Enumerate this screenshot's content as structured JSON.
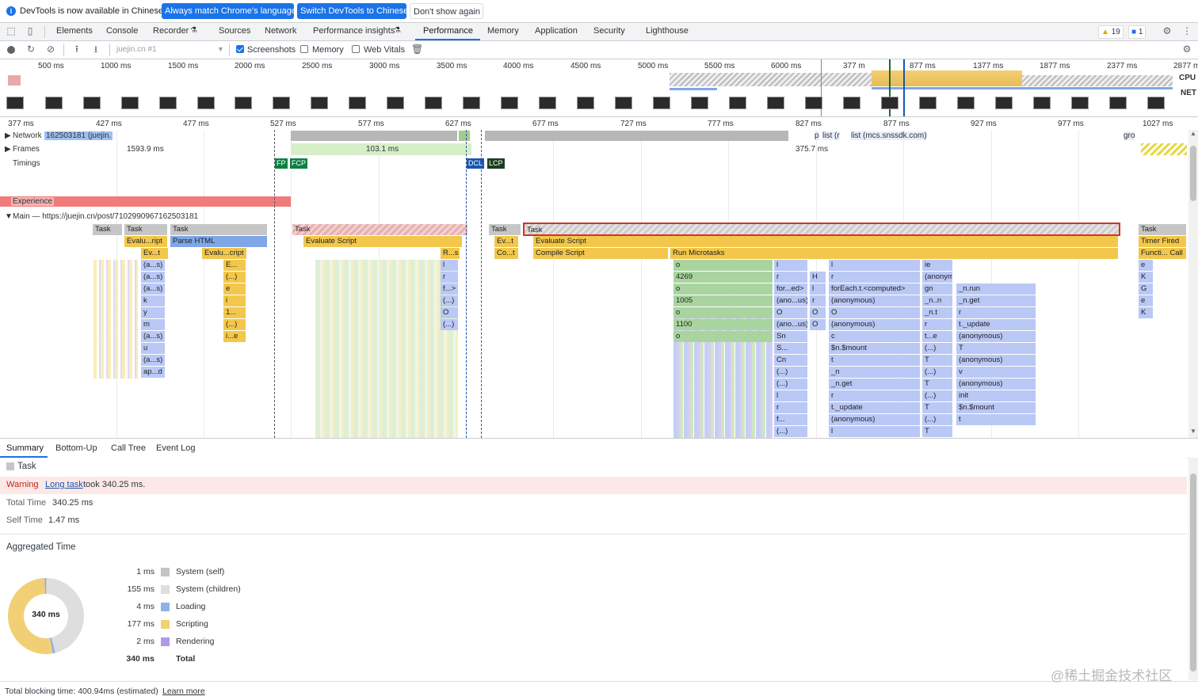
{
  "infobar": {
    "message": "DevTools is now available in Chinese!",
    "btn_match": "Always match Chrome's language",
    "btn_switch": "Switch DevTools to Chinese",
    "btn_dismiss": "Don't show again"
  },
  "tabs": [
    "Elements",
    "Console",
    "Recorder",
    "Sources",
    "Network",
    "Performance insights",
    "Performance",
    "Memory",
    "Application",
    "Security",
    "Lighthouse"
  ],
  "active_tab": "Performance",
  "badges": {
    "warnings": "19",
    "messages": "1"
  },
  "toolbar": {
    "profile_select": "juejin.cn #1",
    "screenshots_label": "Screenshots",
    "screenshots_checked": true,
    "memory_label": "Memory",
    "memory_checked": false,
    "webvitals_label": "Web Vitals",
    "webvitals_checked": false
  },
  "overview": {
    "ticks_left": [
      "500 ms",
      "1000 ms",
      "1500 ms",
      "2000 ms",
      "2500 ms",
      "3000 ms",
      "3500 ms",
      "4000 ms",
      "4500 ms",
      "5000 ms",
      "5500 ms",
      "6000 ms"
    ],
    "ticks_right": [
      "377 m",
      "877 ms",
      "1377 ms",
      "1877 ms",
      "2377 ms",
      "2877 m"
    ],
    "cpu_label": "CPU",
    "net_label": "NET"
  },
  "ruler": [
    "377 ms",
    "427 ms",
    "477 ms",
    "527 ms",
    "577 ms",
    "627 ms",
    "677 ms",
    "727 ms",
    "777 ms",
    "827 ms",
    "877 ms",
    "927 ms",
    "977 ms",
    "1027 ms"
  ],
  "tracks": {
    "network_label": "Network",
    "network_item": "162503181 (juejin.",
    "network_right": [
      "p",
      "list (r",
      "list (mcs.snssdk.com)",
      "gro"
    ],
    "frames_label": "Frames",
    "frames_vals": [
      "1593.9 ms",
      "103.1 ms",
      "375.7 ms"
    ],
    "timings_label": "Timings",
    "markers": [
      "FP",
      "FCP",
      "DCL",
      "LCP"
    ],
    "experience_label": "Experience",
    "main_label": "Main — https://juejin.cn/post/7102990967162503181"
  },
  "flame": {
    "tasks": [
      "Task",
      "Task",
      "Task",
      "Task",
      "Task",
      "Task",
      "Task"
    ],
    "row2": [
      "Evalu...ript",
      "Parse HTML",
      "Evaluate Script",
      "Ev...t",
      "Evaluate Script",
      "Timer Fired"
    ],
    "row3": [
      "Ev...t",
      "Evalu...cript",
      "R...s",
      "Co...t",
      "Compile Script",
      "Run Microtasks",
      "Functi... Call"
    ],
    "col1": [
      "(a...s)",
      "(a...s)",
      "(a...s)",
      "k",
      "y",
      "m",
      "(a...s)",
      "u",
      "(a...s)",
      "ap...d"
    ],
    "col2": [
      "E...",
      "(...)",
      "e",
      "i",
      "1...",
      "(...)",
      "i...e"
    ],
    "col3": [
      "l",
      "r",
      "f...>",
      "(...)",
      "O",
      "(...)"
    ],
    "mt_a": [
      "o",
      "4269",
      "o",
      "1005",
      "o",
      "1100",
      "o"
    ],
    "mt_b": [
      "l",
      "r",
      "for...ed>",
      "(ano...us)",
      "O",
      "(ano...us)",
      "Sn",
      "S...",
      "Cn",
      "(...)",
      "(...)",
      "l",
      "r",
      "f...",
      "(...)"
    ],
    "mt_c": [
      "H",
      "l",
      "r",
      "O",
      "O"
    ],
    "mt_d": [
      "l",
      "r",
      "forEach.t.<computed>",
      "(anonymous)",
      "O",
      "(anonymous)",
      "c",
      "$n.$mount",
      "t",
      "_n",
      "_n.get",
      "r",
      "t._update",
      "(anonymous)",
      "l",
      "$"
    ],
    "mt_e": [
      "ie",
      "(anonymous)",
      "gn",
      "_n..n",
      "_n.t",
      "r",
      "t...e",
      "(...)",
      "T",
      "(...)",
      "T",
      "(...)",
      "T",
      "(...)",
      "T"
    ],
    "mt_f": [
      "_n.run",
      "_n.get",
      "r",
      "t._update",
      "(anonymous)",
      "T",
      "(anonymous)",
      "v",
      "(anonymous)",
      "init",
      "$n.$mount",
      "t"
    ],
    "right": [
      "e",
      "K",
      "G",
      "e",
      "K"
    ]
  },
  "bottom_tabs": [
    "Summary",
    "Bottom-Up",
    "Call Tree",
    "Event Log"
  ],
  "summary": {
    "title": "Task",
    "warning_label": "Warning",
    "warning_link": "Long task",
    "warning_text": "took 340.25 ms.",
    "total_time_label": "Total Time",
    "total_time": "340.25 ms",
    "self_time_label": "Self Time",
    "self_time": "1.47 ms",
    "aggregated_label": "Aggregated Time",
    "donut_center": "340 ms",
    "items": [
      {
        "value": "1 ms",
        "label": "System (self)",
        "color": "#c4c4c4"
      },
      {
        "value": "155 ms",
        "label": "System (children)",
        "color": "#dedede"
      },
      {
        "value": "4 ms",
        "label": "Loading",
        "color": "#8fb3e6"
      },
      {
        "value": "177 ms",
        "label": "Scripting",
        "color": "#f1d075"
      },
      {
        "value": "2 ms",
        "label": "Rendering",
        "color": "#af9ae8"
      }
    ],
    "total_value": "340 ms",
    "total_label": "Total"
  },
  "footer": {
    "text": "Total blocking time: 400.94ms (estimated)",
    "link": "Learn more",
    "watermark": "@稀土掘金技术社区"
  }
}
